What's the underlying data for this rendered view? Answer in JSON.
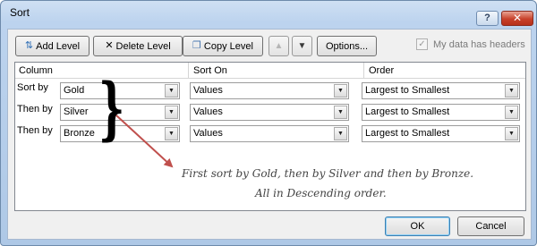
{
  "window": {
    "title": "Sort",
    "help": "?",
    "close": "✕"
  },
  "toolbar": {
    "add_level": "Add Level",
    "delete_level": "Delete Level",
    "copy_level": "Copy Level",
    "options": "Options...",
    "move_up_icon": "triangle-up",
    "move_down_icon": "triangle-down",
    "headers_label": "My data has headers",
    "headers_checked": true
  },
  "grid": {
    "headers": [
      "Column",
      "Sort On",
      "Order"
    ],
    "rows": [
      {
        "label": "Sort by",
        "column": "Gold",
        "sort_on": "Values",
        "order": "Largest to Smallest"
      },
      {
        "label": "Then by",
        "column": "Silver",
        "sort_on": "Values",
        "order": "Largest to Smallest"
      },
      {
        "label": "Then by",
        "column": "Bronze",
        "sort_on": "Values",
        "order": "Largest to Smallest"
      }
    ]
  },
  "annotation": {
    "line1": "First sort by Gold, then by Silver and then by Bronze.",
    "line2": "All in Descending order.",
    "arrow_color": "#c0504d"
  },
  "footer": {
    "ok": "OK",
    "cancel": "Cancel"
  }
}
